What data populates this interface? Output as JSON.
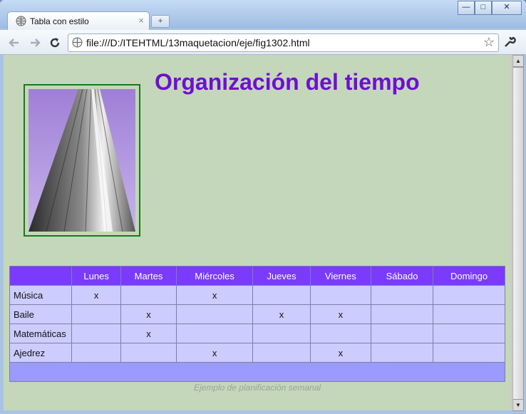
{
  "browser": {
    "tab_title": "Tabla con estilo",
    "tab_close": "×",
    "new_tab": "+",
    "url": "file:///D:/ITEHTML/13maquetacion/eje/fig1302.html",
    "controls": {
      "minimize": "—",
      "maximize": "□",
      "close": "✕"
    },
    "icons": {
      "back": "back-arrow-icon",
      "forward": "forward-arrow-icon",
      "reload": "reload-icon",
      "star": "star-icon",
      "wrench": "wrench-icon"
    }
  },
  "page": {
    "title": "Organización del tiempo",
    "caption": "Ejemplo de planificación semanal",
    "table": {
      "headers": [
        "",
        "Lunes",
        "Martes",
        "Miércoles",
        "Jueves",
        "Viernes",
        "Sábado",
        "Domingo"
      ],
      "rows": [
        {
          "label": "Música",
          "cells": [
            "x",
            "",
            "x",
            "",
            "",
            "",
            ""
          ]
        },
        {
          "label": "Baile",
          "cells": [
            "",
            "x",
            "",
            "x",
            "x",
            "",
            ""
          ]
        },
        {
          "label": "Matemáticas",
          "cells": [
            "",
            "x",
            "",
            "",
            "",
            "",
            ""
          ]
        },
        {
          "label": "Ajedrez",
          "cells": [
            "",
            "",
            "x",
            "",
            "x",
            "",
            ""
          ]
        }
      ]
    }
  },
  "colors": {
    "page_bg": "#c4d7bb",
    "title": "#6f0fd0",
    "header_bg": "#7a3bff",
    "cell_bg": "#ccccff",
    "footer_bg": "#9a9aff",
    "photo_border": "#1a7a1a"
  }
}
